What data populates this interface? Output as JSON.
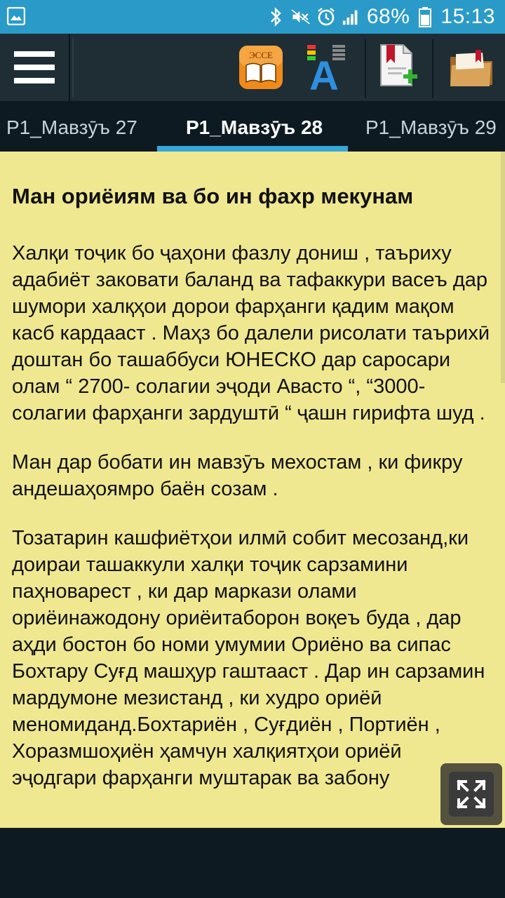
{
  "status_bar": {
    "battery_percent": "68%",
    "time": "15:13",
    "icons": [
      "gallery-icon",
      "bluetooth-icon",
      "mute-icon",
      "alarm-icon",
      "signal-icon",
      "battery-icon"
    ]
  },
  "toolbar": {
    "menu_icon": "hamburger-icon",
    "essay_icon_label": "ЭССЕ",
    "font_icon_letter": "A",
    "buttons": [
      "essay-book-icon",
      "font-size-icon",
      "add-bookmark-icon",
      "folder-bookmark-icon"
    ]
  },
  "tabs": [
    {
      "label": "Р1_Мавзӯъ 27",
      "active": false
    },
    {
      "label": "Р1_Мавзӯъ 28",
      "active": true
    },
    {
      "label": "Р1_Мавзӯъ 29",
      "active": false
    }
  ],
  "article": {
    "title": "Ман ориёиям ва бо ин фахр мекунам",
    "paragraphs": [
      "Халқи тоҷик бо ҷаҳони фазлу дониш , таъриху адабиёт заковати баланд ва тафаккури васеъ дар шумори халқҳои дорои фарҳанги қадим мақом касб кардааст . Маҳз бо далели рисолати таърихӣ доштан бо ташаббуси ЮНЕСКО дар саросари олам “ 2700- солагии эҷоди Авасто “, “3000-солагии фарҳанги зардуштӣ “ ҷашн гирифта шуд .",
      "Ман дар бобати ин мавзӯъ мехостам , ки фикру андешаҳоямро баён созам .",
      "Тозатарин кашфиётҳои илмӣ собит месозанд,ки доираи ташаккули халқи тоҷик сарзамини паҳноварест , ки дар маркази олами ориёинажодону ориёитаборон воқеъ буда , дар аҳди бостон бо номи умумии Ориёно ва сипас Бохтару Суғд машҳур гаштааст . Дар ин сарзамин мардумоне мезистанд , ки худро ориёӣ меномиданд.Бохтариён , Суғдиён , Портиён , Хоразмшоҳиён ҳамчун халқиятҳои ориёӣ эҷодгари фарҳанги муштарак ва забону"
    ]
  },
  "fullscreen_button": "expand-icon"
}
